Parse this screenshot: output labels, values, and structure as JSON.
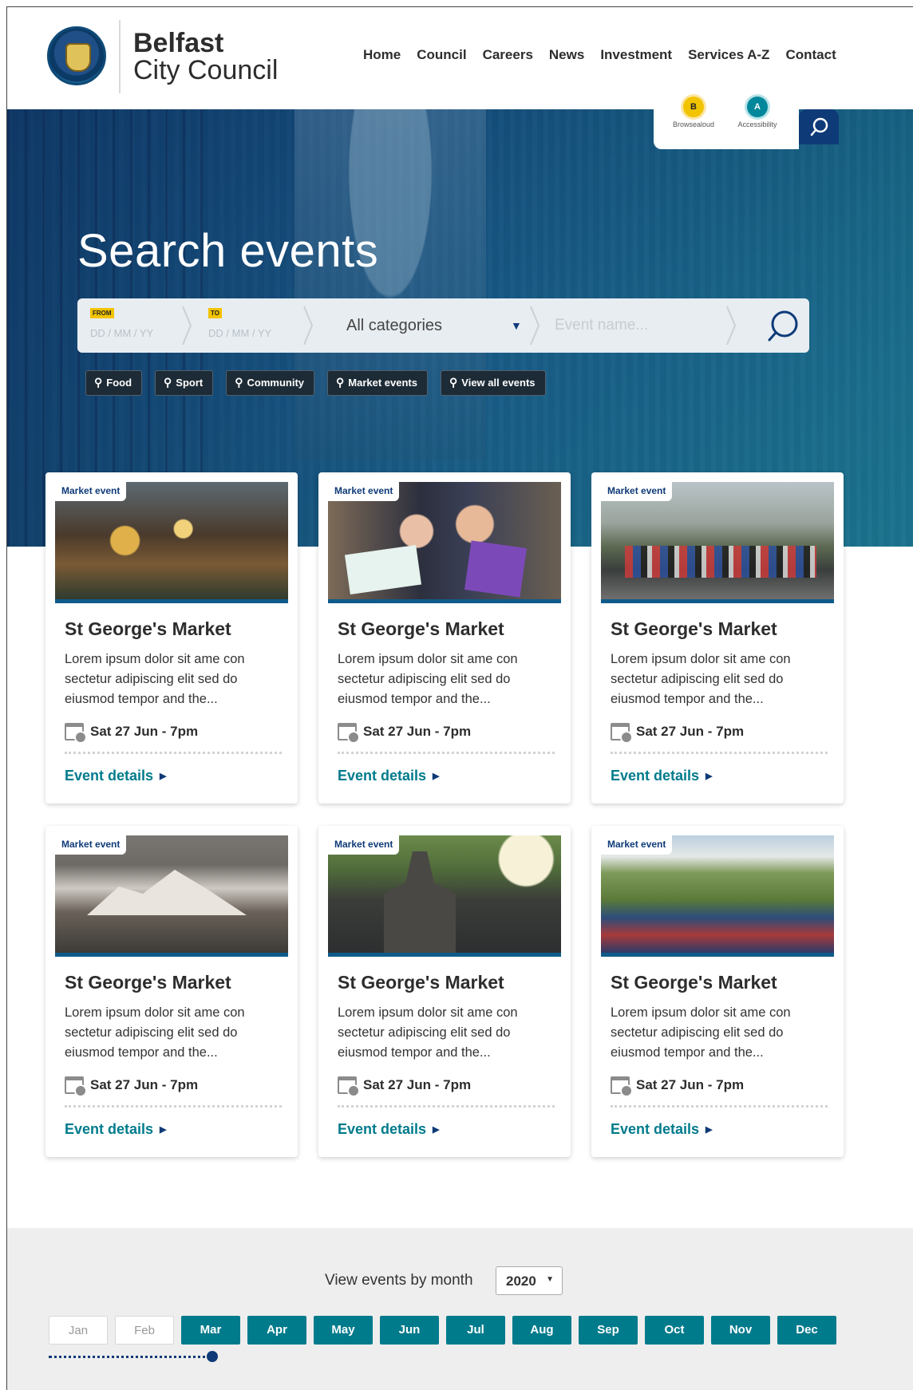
{
  "brand": {
    "name_line1": "Belfast",
    "name_line2": "City Council"
  },
  "nav": [
    "Home",
    "Council",
    "Careers",
    "News",
    "Investment",
    "Services A-Z",
    "Contact"
  ],
  "utilities": [
    {
      "badge": "B",
      "label": "Browsealoud"
    },
    {
      "badge": "A",
      "label": "Accessibility"
    }
  ],
  "hero": {
    "title": "Search events"
  },
  "search": {
    "from_label": "FROM",
    "from_placeholder": "DD / MM / YY",
    "to_label": "TO",
    "to_placeholder": "DD / MM / YY",
    "category_value": "All categories",
    "event_placeholder": "Event name..."
  },
  "chips": [
    "Food",
    "Sport",
    "Community",
    "Market events",
    "View all events"
  ],
  "cards": [
    {
      "tag": "Market event",
      "title": "St George's Market",
      "desc": "Lorem ipsum dolor sit ame con sectetur adipiscing elit sed do eiusmod tempor and the...",
      "date": "Sat 27 Jun - 7pm",
      "link": "Event details"
    },
    {
      "tag": "Market event",
      "title": "St George's Market",
      "desc": "Lorem ipsum dolor sit ame con sectetur adipiscing elit sed do eiusmod tempor and the...",
      "date": "Sat 27 Jun - 7pm",
      "link": "Event details"
    },
    {
      "tag": "Market event",
      "title": "St George's Market",
      "desc": "Lorem ipsum dolor sit ame con sectetur adipiscing elit sed do eiusmod tempor and the...",
      "date": "Sat 27 Jun - 7pm",
      "link": "Event details"
    },
    {
      "tag": "Market event",
      "title": "St George's Market",
      "desc": "Lorem ipsum dolor sit ame con sectetur adipiscing elit sed do eiusmod tempor and the...",
      "date": "Sat 27 Jun - 7pm",
      "link": "Event details"
    },
    {
      "tag": "Market event",
      "title": "St George's Market",
      "desc": "Lorem ipsum dolor sit ame con sectetur adipiscing elit sed do eiusmod tempor and the...",
      "date": "Sat 27 Jun - 7pm",
      "link": "Event details"
    },
    {
      "tag": "Market event",
      "title": "St George's Market",
      "desc": "Lorem ipsum dolor sit ame con sectetur adipiscing elit sed do eiusmod tempor and the...",
      "date": "Sat 27 Jun - 7pm",
      "link": "Event details"
    }
  ],
  "months_section": {
    "label": "View events by month",
    "year": "2020",
    "months": [
      "Jan",
      "Feb",
      "Mar",
      "Apr",
      "May",
      "Jun",
      "Jul",
      "Aug",
      "Sep",
      "Oct",
      "Nov",
      "Dec"
    ],
    "past_months": [
      "Jan",
      "Feb"
    ],
    "current_month": "Mar"
  },
  "colors": {
    "navy": "#0e3a78",
    "teal": "#007b8c",
    "yellow": "#f2c400"
  }
}
